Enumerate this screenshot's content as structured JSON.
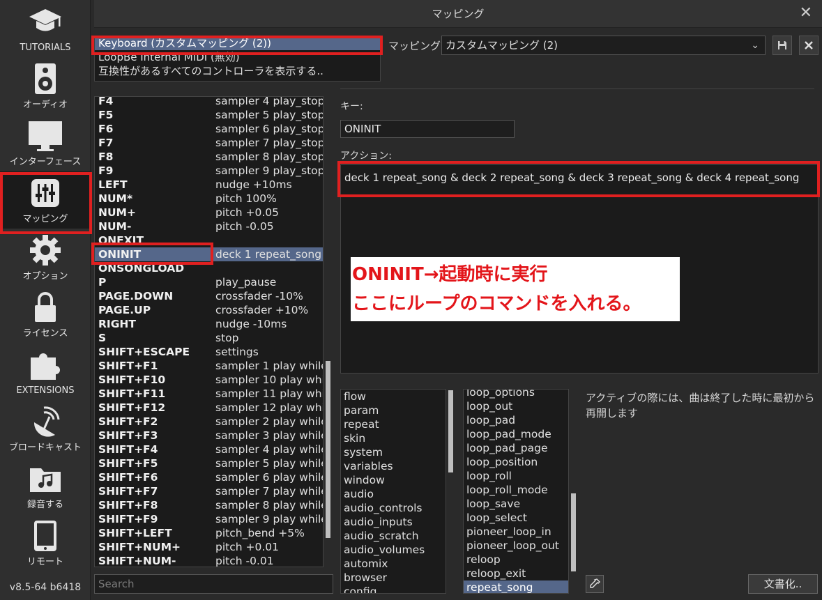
{
  "window": {
    "title": "マッピング",
    "close_glyph": "✕"
  },
  "sidebar": {
    "items": [
      {
        "label": "TUTORIALS",
        "icon": "graduation-cap-icon"
      },
      {
        "label": "オーディオ",
        "icon": "speaker-icon"
      },
      {
        "label": "インターフェース",
        "icon": "monitor-icon"
      },
      {
        "label": "マッピング",
        "icon": "sliders-icon"
      },
      {
        "label": "オプション",
        "icon": "gear-icon"
      },
      {
        "label": "ライセンス",
        "icon": "lock-icon"
      },
      {
        "label": "EXTENSIONS",
        "icon": "puzzle-icon"
      },
      {
        "label": "ブロードキャスト",
        "icon": "satellite-dish-icon"
      },
      {
        "label": "録音する",
        "icon": "music-folder-icon"
      },
      {
        "label": "リモート",
        "icon": "tablet-icon"
      }
    ],
    "version": "v8.5-64 b6418"
  },
  "devices": [
    "Keyboard (カスタムマッピング (2))",
    "LoopBe Internal MIDI (無効)",
    "互換性があるすべてのコントローラを表示する.."
  ],
  "mapping": {
    "label": "マッピング:",
    "value": "カスタムマッピング (2)",
    "chevron": "⌄"
  },
  "keys": [
    {
      "key": "F4",
      "action": "sampler 4 play_stop"
    },
    {
      "key": "F5",
      "action": "sampler 5 play_stop"
    },
    {
      "key": "F6",
      "action": "sampler 6 play_stop"
    },
    {
      "key": "F7",
      "action": "sampler 7 play_stop"
    },
    {
      "key": "F8",
      "action": "sampler 8 play_stop"
    },
    {
      "key": "F9",
      "action": "sampler 9 play_stop"
    },
    {
      "key": "LEFT",
      "action": "nudge +10ms"
    },
    {
      "key": "NUM*",
      "action": "pitch 100%"
    },
    {
      "key": "NUM+",
      "action": "pitch +0.05"
    },
    {
      "key": "NUM-",
      "action": "pitch -0.05"
    },
    {
      "key": "ONEXIT",
      "action": ""
    },
    {
      "key": "ONINIT",
      "action": "deck 1 repeat_song"
    },
    {
      "key": "ONSONGLOAD",
      "action": ""
    },
    {
      "key": "P",
      "action": "play_pause"
    },
    {
      "key": "PAGE.DOWN",
      "action": "crossfader -10%"
    },
    {
      "key": "PAGE.UP",
      "action": "crossfader +10%"
    },
    {
      "key": "RIGHT",
      "action": "nudge -10ms"
    },
    {
      "key": "S",
      "action": "stop"
    },
    {
      "key": "SHIFT+ESCAPE",
      "action": "settings"
    },
    {
      "key": "SHIFT+F1",
      "action": "sampler 1 play while"
    },
    {
      "key": "SHIFT+F10",
      "action": "sampler 10 play whil"
    },
    {
      "key": "SHIFT+F11",
      "action": "sampler 11 play whil"
    },
    {
      "key": "SHIFT+F12",
      "action": "sampler 12 play whil"
    },
    {
      "key": "SHIFT+F2",
      "action": "sampler 2 play while"
    },
    {
      "key": "SHIFT+F3",
      "action": "sampler 3 play while"
    },
    {
      "key": "SHIFT+F4",
      "action": "sampler 4 play while"
    },
    {
      "key": "SHIFT+F5",
      "action": "sampler 5 play while"
    },
    {
      "key": "SHIFT+F6",
      "action": "sampler 6 play while"
    },
    {
      "key": "SHIFT+F7",
      "action": "sampler 7 play while"
    },
    {
      "key": "SHIFT+F8",
      "action": "sampler 8 play while"
    },
    {
      "key": "SHIFT+F9",
      "action": "sampler 9 play while"
    },
    {
      "key": "SHIFT+LEFT",
      "action": "pitch_bend +5%"
    },
    {
      "key": "SHIFT+NUM+",
      "action": "pitch +0.01"
    },
    {
      "key": "SHIFT+NUM-",
      "action": "pitch -0.01"
    }
  ],
  "selected_key": "ONINIT",
  "search_placeholder": "Search",
  "key_label": "キー:",
  "key_value": "ONINIT",
  "action_label": "アクション:",
  "action_value": "deck 1 repeat_song & deck 2 repeat_song & deck 3 repeat_song & deck 4 repeat_song",
  "note": {
    "line1": "ONINIT→起動時に実行",
    "line2": "ここにループのコマンドを入れる。"
  },
  "categories": [
    "flow",
    "param",
    "repeat",
    "skin",
    "system",
    "variables",
    "window",
    "audio",
    "audio_controls",
    "audio_inputs",
    "audio_scratch",
    "audio_volumes",
    "automix",
    "browser",
    "config"
  ],
  "verbs": [
    "loop_options",
    "loop_out",
    "loop_pad",
    "loop_pad_mode",
    "loop_pad_page",
    "loop_position",
    "loop_roll",
    "loop_roll_mode",
    "loop_save",
    "loop_select",
    "pioneer_loop_in",
    "pioneer_loop_out",
    "reloop",
    "reloop_exit",
    "repeat_song"
  ],
  "selected_verb": "repeat_song",
  "description": "アクティブの際には、曲は終了した時に最初から再開します",
  "doc_button": "文書化..",
  "colors": {
    "highlight_red": "#e02020",
    "selection_blue": "#55678a",
    "note_red": "#e3151a"
  }
}
